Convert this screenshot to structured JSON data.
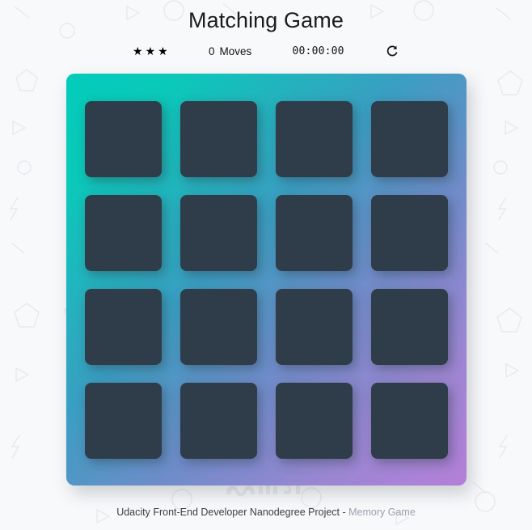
{
  "header": {
    "title": "Matching Game"
  },
  "score_panel": {
    "stars": [
      "star-icon",
      "star-icon",
      "star-icon"
    ],
    "star_glyph": "★",
    "star_count": 3,
    "moves_count": "0",
    "moves_label": "Moves",
    "timer": "00:00:00",
    "restart_icon": "restart-icon",
    "restart_label": "Restart"
  },
  "deck": {
    "rows": 4,
    "columns": 4,
    "cards": [
      {
        "id": 1,
        "state": "face-down",
        "symbol": ""
      },
      {
        "id": 2,
        "state": "face-down",
        "symbol": ""
      },
      {
        "id": 3,
        "state": "face-down",
        "symbol": ""
      },
      {
        "id": 4,
        "state": "face-down",
        "symbol": ""
      },
      {
        "id": 5,
        "state": "face-down",
        "symbol": ""
      },
      {
        "id": 6,
        "state": "face-down",
        "symbol": ""
      },
      {
        "id": 7,
        "state": "face-down",
        "symbol": ""
      },
      {
        "id": 8,
        "state": "face-down",
        "symbol": ""
      },
      {
        "id": 9,
        "state": "face-down",
        "symbol": ""
      },
      {
        "id": 10,
        "state": "face-down",
        "symbol": ""
      },
      {
        "id": 11,
        "state": "face-down",
        "symbol": ""
      },
      {
        "id": 12,
        "state": "face-down",
        "symbol": ""
      },
      {
        "id": 13,
        "state": "face-down",
        "symbol": ""
      },
      {
        "id": 14,
        "state": "face-down",
        "symbol": ""
      },
      {
        "id": 15,
        "state": "face-down",
        "symbol": ""
      },
      {
        "id": 16,
        "state": "face-down",
        "symbol": ""
      }
    ]
  },
  "footer": {
    "text": "Udacity Front-End Developer Nanodegree Project - ",
    "link_text": "Memory Game"
  },
  "watermark": {
    "text": "مستقل"
  },
  "colors": {
    "page_background": "#f8f9fb",
    "deck_gradient_start": "#02ccba",
    "deck_gradient_mid": "#4a90b8",
    "deck_gradient_end": "#b47fd8",
    "card_face_down": "#2e3d49",
    "title_text": "#1b1b1d",
    "footer_text": "#3d3d42",
    "footer_link": "#9aa0b0"
  }
}
